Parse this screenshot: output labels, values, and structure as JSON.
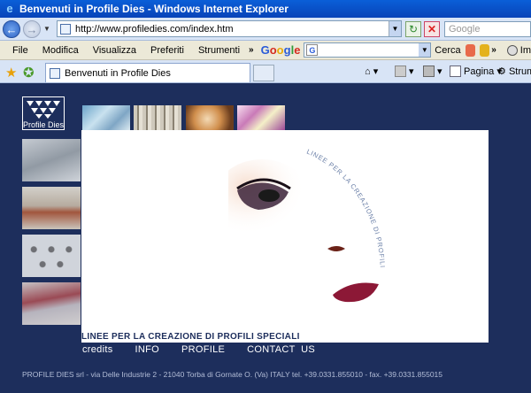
{
  "window": {
    "title": "Benvenuti in Profile Dies - Windows Internet Explorer"
  },
  "address_bar": {
    "url": "http://www.profiledies.com/index.htm"
  },
  "search": {
    "placeholder": "Google"
  },
  "menu": {
    "items": [
      "File",
      "Modifica",
      "Visualizza",
      "Preferiti",
      "Strumenti"
    ],
    "more": "»",
    "google_search_label": "Cerca",
    "more_right": "»",
    "right_truncated": "Im"
  },
  "tabs": [
    {
      "label": "Benvenuti in Profile Dies"
    }
  ],
  "commands": {
    "page": "Pagina",
    "tools": "Strum"
  },
  "site": {
    "logo_label": "Profile Dies",
    "arc_text": "LINEE PER LA CREAZIONE DI PROFILI SPECIALI",
    "tagline": "LINEE PER LA CREAZIONE DI PROFILI SPECIALI",
    "nav": [
      "credits",
      "INFO",
      "PROFILE",
      "CONTACT  US"
    ],
    "footer": "PROFILE DIES srl - via Delle Industrie 2 - 21040 Torba di Gornate O. (Va) ITALY tel. +39.0331.855010 - fax. +39.0331.855015"
  },
  "colors": {
    "site_background": "#1d2e5c",
    "titlebar": "#0843b8"
  },
  "icons": {
    "back": "back-arrow-icon",
    "forward": "forward-arrow-icon",
    "refresh": "refresh-icon",
    "stop": "stop-icon",
    "favorites": "star-icon",
    "add_favorite": "add-favorite-icon",
    "home": "home-icon",
    "feeds": "rss-icon",
    "print": "print-icon"
  }
}
